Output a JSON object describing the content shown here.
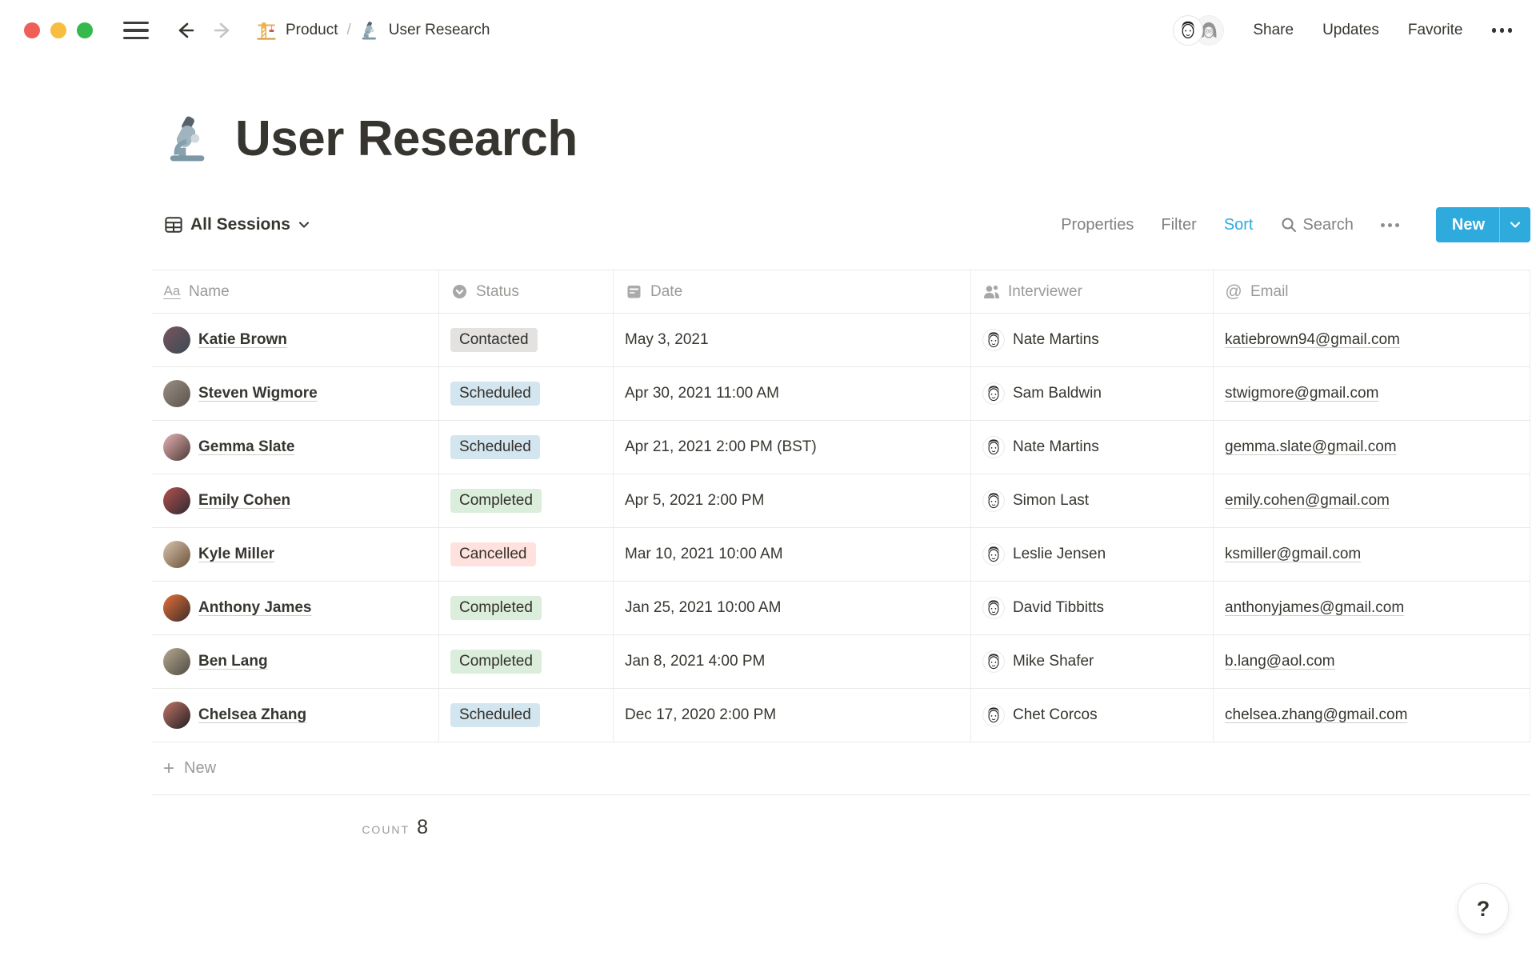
{
  "colors": {
    "accent": "#2EAADC",
    "traffic": {
      "close": "#F05F57",
      "minimize": "#F6BD3E",
      "zoom": "#35B84C"
    },
    "status": {
      "Contacted": "#E3E2E0",
      "Scheduled": "#D3E5EF",
      "Completed": "#DBEDDB",
      "Cancelled": "#FFE2DD"
    }
  },
  "topbar": {
    "breadcrumb": {
      "parent": "Product",
      "separator": "/",
      "current": "User Research"
    },
    "actions": {
      "share": "Share",
      "updates": "Updates",
      "favorite": "Favorite"
    },
    "icons": [
      "hamburger-icon",
      "back-arrow-icon",
      "forward-arrow-icon",
      "crane-icon",
      "microscope-icon",
      "more-icon",
      "collaborator-avatars"
    ]
  },
  "page": {
    "icon": "microscope-icon",
    "title": "User Research"
  },
  "view": {
    "name": "All Sessions",
    "properties": "Properties",
    "filter": "Filter",
    "sort": "Sort",
    "search": "Search",
    "new_label": "New"
  },
  "table": {
    "columns": [
      {
        "icon": "text-icon",
        "label": "Name"
      },
      {
        "icon": "select-icon",
        "label": "Status"
      },
      {
        "icon": "calendar-icon",
        "label": "Date"
      },
      {
        "icon": "person-icon",
        "label": "Interviewer"
      },
      {
        "icon": "at-icon",
        "label": "Email"
      }
    ],
    "rows": [
      {
        "name": "Katie Brown",
        "status": "Contacted",
        "date": "May 3, 2021",
        "interviewer": "Nate Martins",
        "email": "katiebrown94@gmail.com",
        "avatar": [
          "#7a5560",
          "#3a4a52"
        ]
      },
      {
        "name": "Steven Wigmore",
        "status": "Scheduled",
        "date": "Apr 30, 2021 11:00 AM",
        "interviewer": "Sam Baldwin",
        "email": "stwigmore@gmail.com",
        "avatar": [
          "#9a8f85",
          "#5a524b"
        ]
      },
      {
        "name": "Gemma Slate",
        "status": "Scheduled",
        "date": "Apr 21, 2021 2:00 PM (BST)",
        "interviewer": "Nate Martins",
        "email": "gemma.slate@gmail.com",
        "avatar": [
          "#e8b2b5",
          "#4a3a35"
        ]
      },
      {
        "name": "Emily Cohen",
        "status": "Completed",
        "date": "Apr 5, 2021 2:00 PM",
        "interviewer": "Simon Last",
        "email": "emily.cohen@gmail.com",
        "avatar": [
          "#b5524e",
          "#2e2a33"
        ]
      },
      {
        "name": "Kyle Miller",
        "status": "Cancelled",
        "date": "Mar 10, 2021 10:00 AM",
        "interviewer": "Leslie Jensen",
        "email": "ksmiller@gmail.com",
        "avatar": [
          "#d9c4ae",
          "#6b5138"
        ]
      },
      {
        "name": "Anthony James",
        "status": "Completed",
        "date": "Jan 25, 2021 10:00 AM",
        "interviewer": "David Tibbitts",
        "email": "anthonyjames@gmail.com",
        "avatar": [
          "#e8703a",
          "#3a2d28"
        ]
      },
      {
        "name": "Ben Lang",
        "status": "Completed",
        "date": "Jan 8, 2021 4:00 PM",
        "interviewer": "Mike Shafer",
        "email": "b.lang@aol.com",
        "avatar": [
          "#b8a98f",
          "#4e4a45"
        ]
      },
      {
        "name": "Chelsea Zhang",
        "status": "Scheduled",
        "date": "Dec 17, 2020 2:00 PM",
        "interviewer": "Chet Corcos",
        "email": "chelsea.zhang@gmail.com",
        "avatar": [
          "#c2766a",
          "#221f20"
        ]
      }
    ],
    "footer": {
      "new_row_label": "New",
      "count_label": "COUNT",
      "count_value": "8"
    }
  },
  "help": {
    "label": "?"
  }
}
